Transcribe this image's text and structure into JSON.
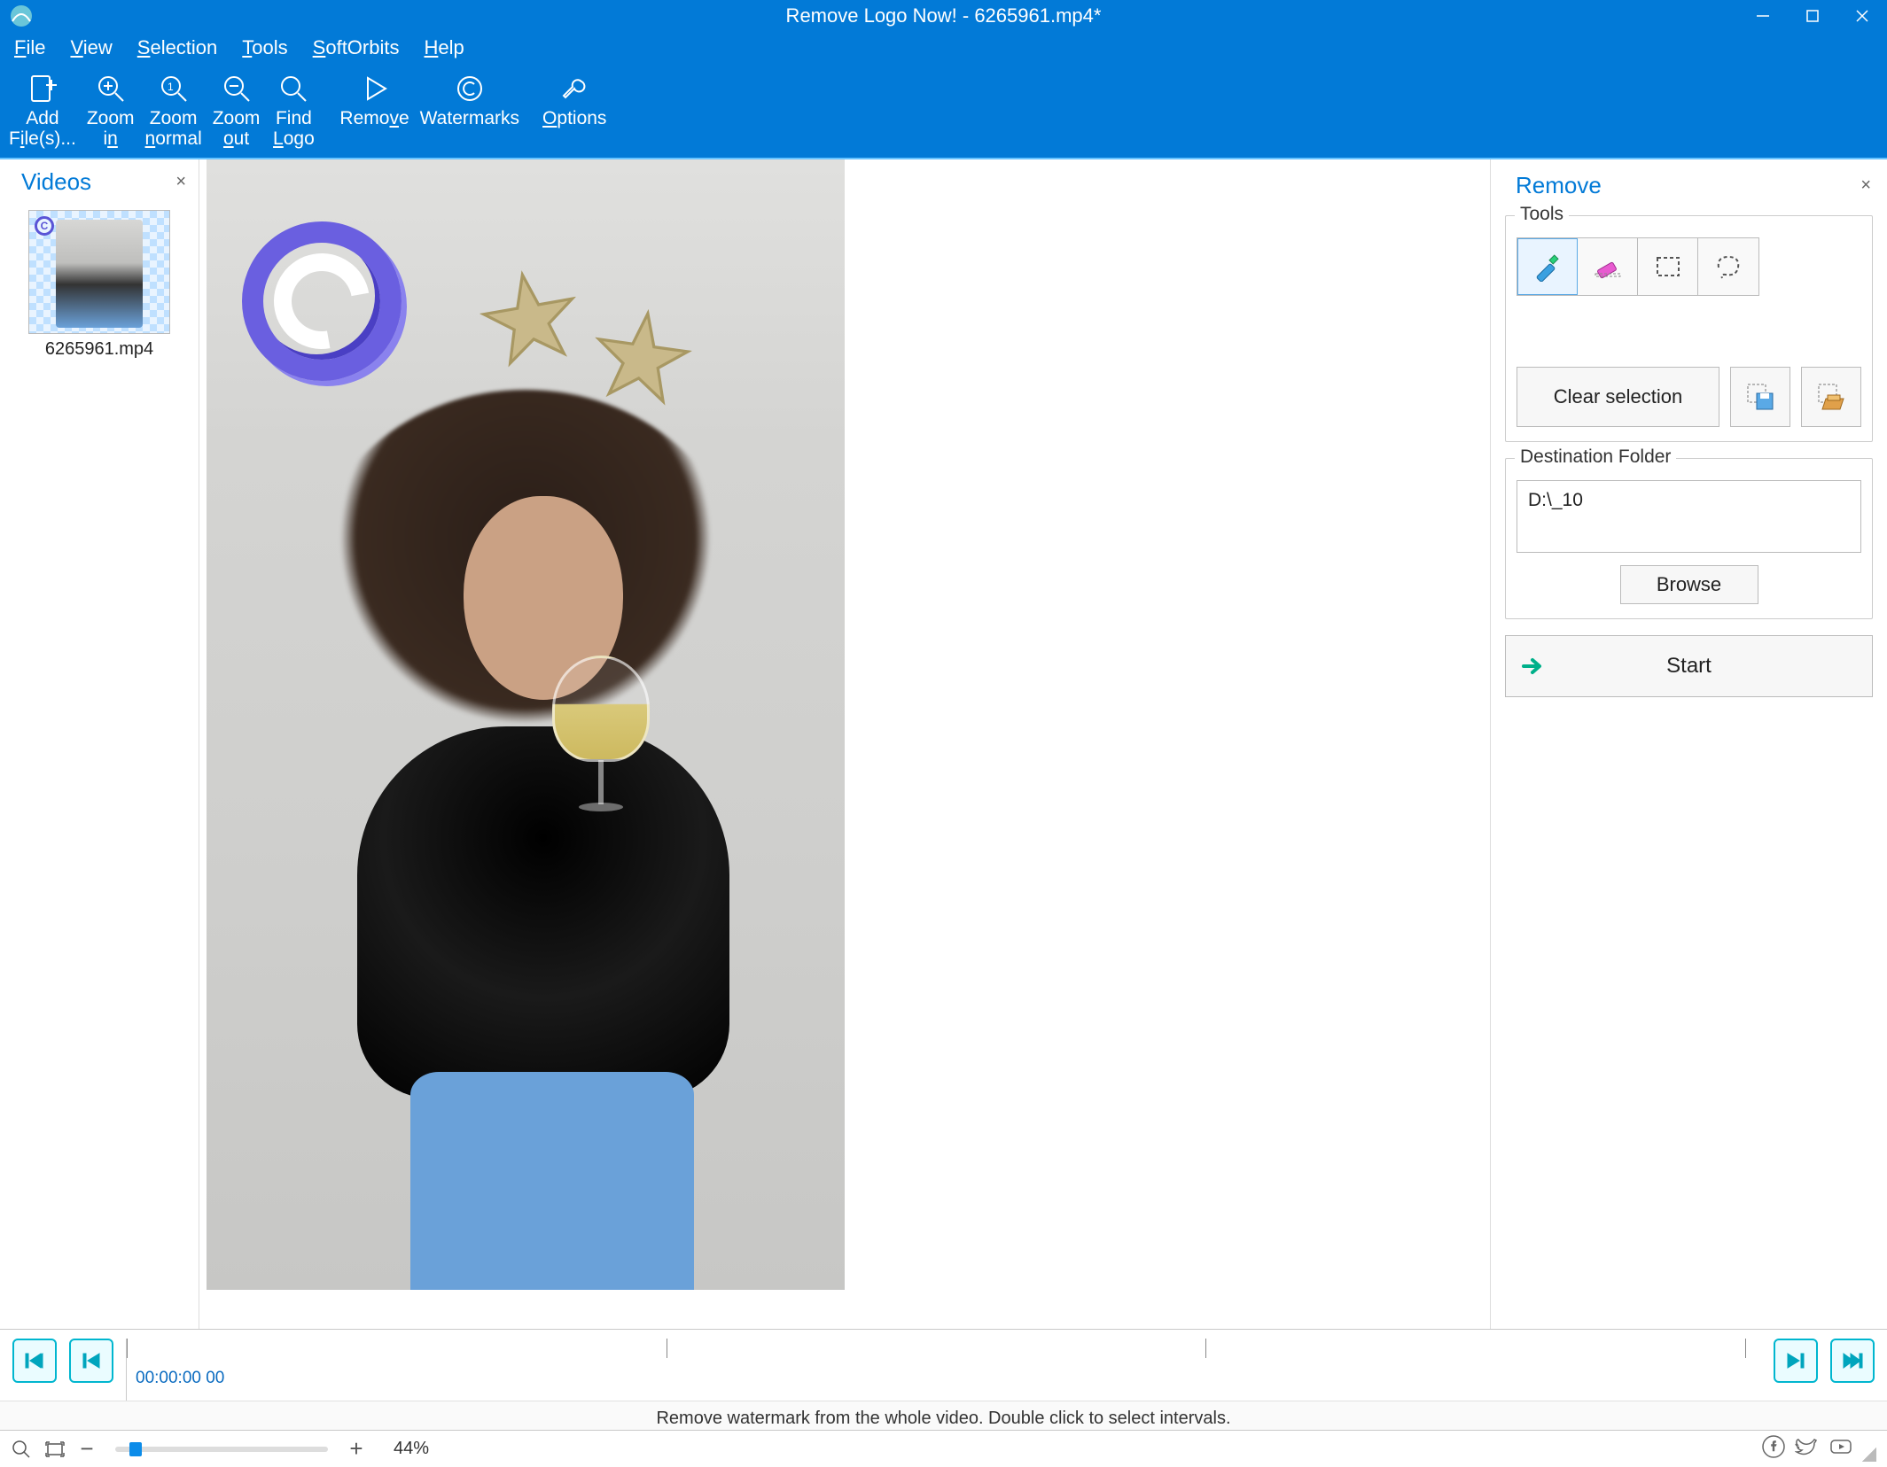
{
  "title": "Remove Logo Now! - 6265961.mp4*",
  "menu": {
    "items": [
      "File",
      "View",
      "Selection",
      "Tools",
      "SoftOrbits",
      "Help"
    ]
  },
  "toolbar": {
    "add": "Add\nFile(s)...",
    "zoom_in": "Zoom\nin",
    "zoom_normal": "Zoom\nnormal",
    "zoom_out": "Zoom\nout",
    "find_logo": "Find\nLogo",
    "remove": "Remove",
    "watermarks": "Watermarks",
    "options": "Options"
  },
  "sidebar": {
    "title": "Videos",
    "items": [
      {
        "name": "6265961.mp4"
      }
    ]
  },
  "right": {
    "title": "Remove",
    "tools_legend": "Tools",
    "clear": "Clear selection",
    "dest_legend": "Destination Folder",
    "dest_value": "D:\\_10",
    "browse": "Browse",
    "start": "Start"
  },
  "timeline": {
    "timecode": "00:00:00 00",
    "hint": "Remove watermark from the whole video. Double click to select intervals."
  },
  "status": {
    "zoom": "44%"
  }
}
